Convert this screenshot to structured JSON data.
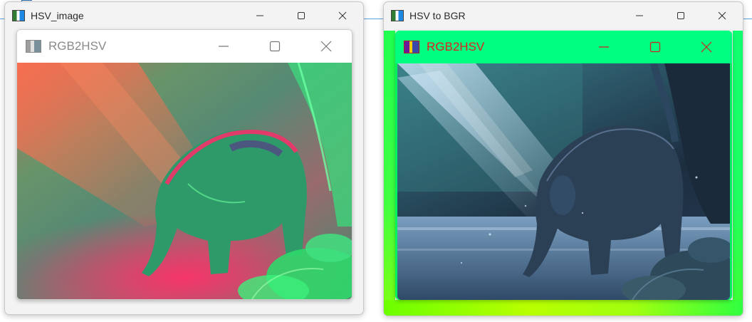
{
  "windows": {
    "left": {
      "title": "HSV_image",
      "inner_title": "RGB2HSV"
    },
    "right": {
      "title": "HSV to BGR",
      "inner_title": "RGB2HSV"
    }
  },
  "icons": {
    "minimize": "minimize-icon",
    "maximize": "maximize-icon",
    "close": "close-icon",
    "app": "app-icon"
  },
  "colors": {
    "inner_title_left": "#8a8a8a",
    "inner_title_right": "#e02020",
    "right_frame_green": "#00ff80"
  }
}
